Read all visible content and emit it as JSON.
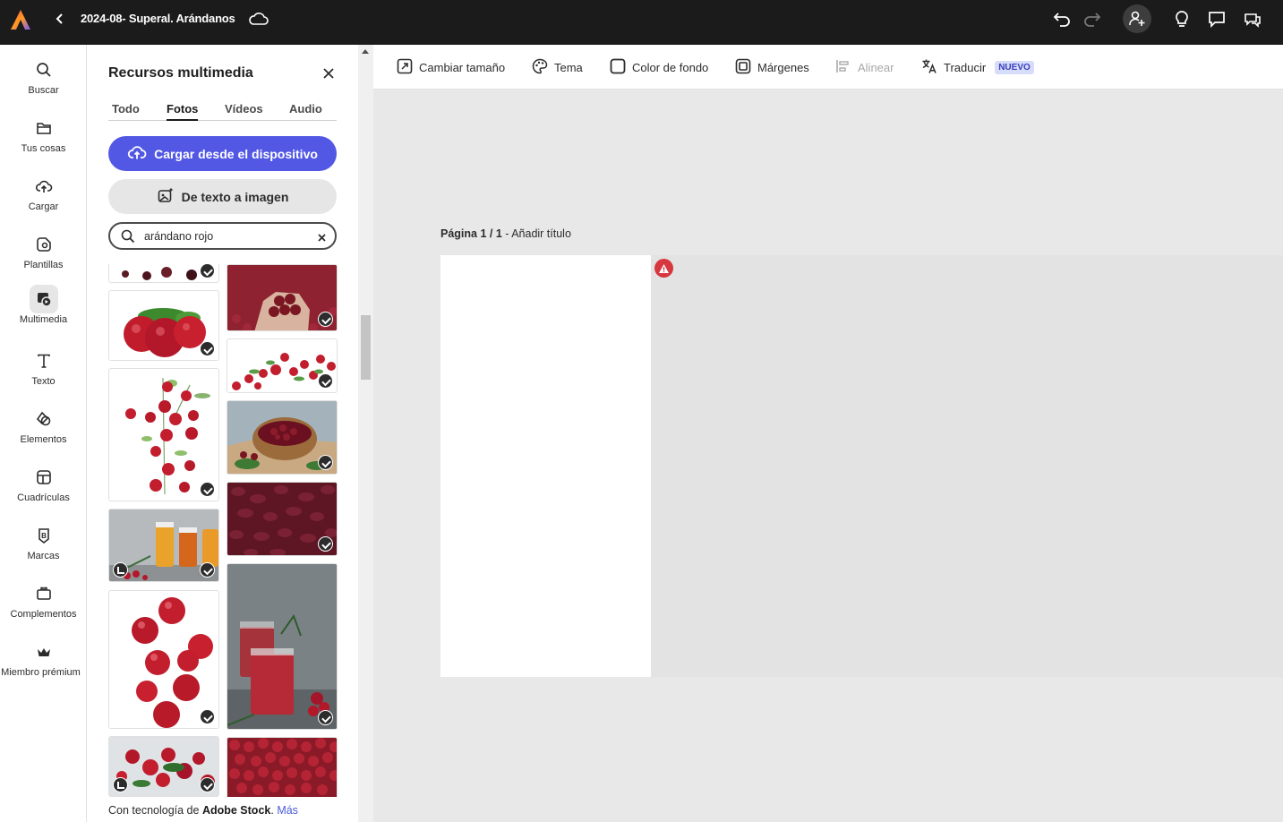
{
  "topbar": {
    "document_title": "2024-08- Superal. Arándanos",
    "icons": [
      "adobe-express-logo-icon",
      "chevron-left-icon",
      "cloud-icon",
      "undo-icon",
      "redo-icon",
      "invite-user-icon",
      "lightbulb-icon",
      "comment-icon",
      "share-comments-icon"
    ]
  },
  "rail": {
    "items": [
      {
        "label": "Buscar",
        "icon": "search-icon"
      },
      {
        "label": "Tus cosas",
        "icon": "folder-icon"
      },
      {
        "label": "Cargar",
        "icon": "upload-cloud-icon"
      },
      {
        "label": "Plantillas",
        "icon": "templates-icon"
      },
      {
        "label": "Multimedia",
        "icon": "media-icon"
      },
      {
        "label": "Texto",
        "icon": "text-icon"
      },
      {
        "label": "Elementos",
        "icon": "shapes-icon"
      },
      {
        "label": "Cuadrículas",
        "icon": "grid-icon"
      },
      {
        "label": "Marcas",
        "icon": "brand-icon"
      },
      {
        "label": "Complementos",
        "icon": "addons-icon"
      },
      {
        "label": "Miembro prémium",
        "icon": "crown-icon"
      }
    ],
    "active": "Multimedia"
  },
  "panel": {
    "title": "Recursos multimedia",
    "tabs": [
      "Todo",
      "Fotos",
      "Vídeos",
      "Audio"
    ],
    "active_tab": "Fotos",
    "upload_button": "Cargar desde el dispositivo",
    "text_to_image_button": "De texto a imagen",
    "search_value": "arándano rojo",
    "footer_prefix": "Con tecnología de ",
    "footer_brand": "Adobe Stock",
    "footer_suffix": ". ",
    "footer_link": "Más"
  },
  "toolbar": {
    "resize": "Cambiar tamaño",
    "theme": "Tema",
    "background_color": "Color de fondo",
    "margins": "Márgenes",
    "align": "Alinear",
    "translate": "Traducir",
    "new_badge": "NUEVO"
  },
  "canvas": {
    "page_label_bold": "Página 1 / 1",
    "page_label_rest": " - Añadir título"
  },
  "colors": {
    "accent": "#5258e4",
    "topbar": "#1b1b1b",
    "warning": "#d7373f",
    "cranberry": "#b01e2c"
  }
}
